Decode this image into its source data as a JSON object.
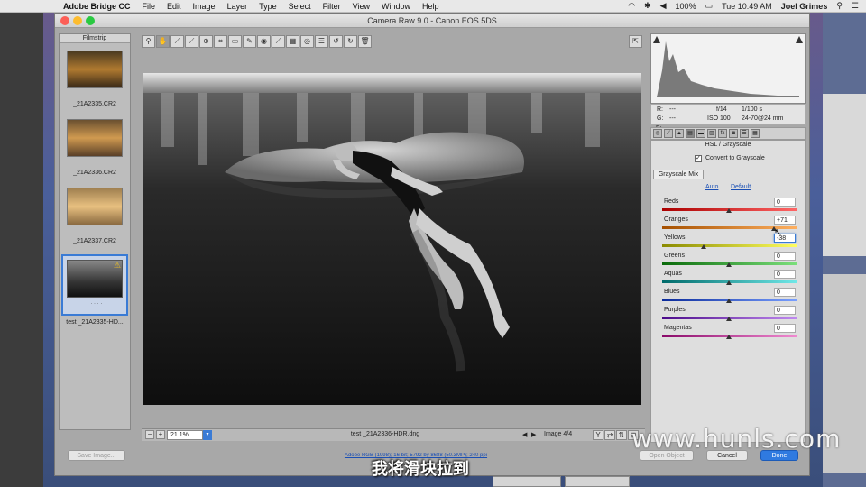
{
  "menubar": {
    "app_name": "Adobe Bridge CC",
    "items": [
      "File",
      "Edit",
      "Image",
      "Layer",
      "Type",
      "Select",
      "Filter",
      "View",
      "Window",
      "Help"
    ],
    "battery": "100%",
    "clock": "Tue 10:49 AM",
    "user": "Joel Grimes"
  },
  "window": {
    "title": "Camera Raw 9.0  -  Canon EOS 5DS"
  },
  "filmstrip": {
    "header": "Filmstrip",
    "items": [
      {
        "label": "_21A2335.CR2"
      },
      {
        "label": "_21A2336.CR2"
      },
      {
        "label": "_21A2337.CR2"
      },
      {
        "label": "test _21A2335-HD..."
      }
    ]
  },
  "preview": {
    "filename": "test _21A2336-HDR.dng",
    "zoom": "21.1%",
    "image_counter": "Image 4/4"
  },
  "info": {
    "r_label": "R:",
    "g_label": "G:",
    "b_label": "B:",
    "r": "---",
    "g": "---",
    "b": "---",
    "aperture": "f/14",
    "shutter": "1/100 s",
    "iso": "ISO 100",
    "lens": "24-70@24 mm"
  },
  "hsl": {
    "title": "HSL / Grayscale",
    "convert_label": "Convert to Grayscale",
    "tab": "Grayscale Mix",
    "auto": "Auto",
    "default": "Default",
    "sliders": [
      {
        "label": "Reds",
        "value": "0"
      },
      {
        "label": "Oranges",
        "value": "+71"
      },
      {
        "label": "Yellows",
        "value": "-38"
      },
      {
        "label": "Greens",
        "value": "0"
      },
      {
        "label": "Aquas",
        "value": "0"
      },
      {
        "label": "Blues",
        "value": "0"
      },
      {
        "label": "Purples",
        "value": "0"
      },
      {
        "label": "Magentas",
        "value": "0"
      }
    ]
  },
  "buttons": {
    "save_image": "Save Image...",
    "workflow_link": "Adobe RGB (1998); 16 bit; 5792 by 8688 (50.3MP); 240 ppi",
    "open_object": "Open Object",
    "cancel": "Cancel",
    "done": "Done"
  },
  "watermark": "www.hunls.com",
  "subtitle": "我将滑块拉到"
}
